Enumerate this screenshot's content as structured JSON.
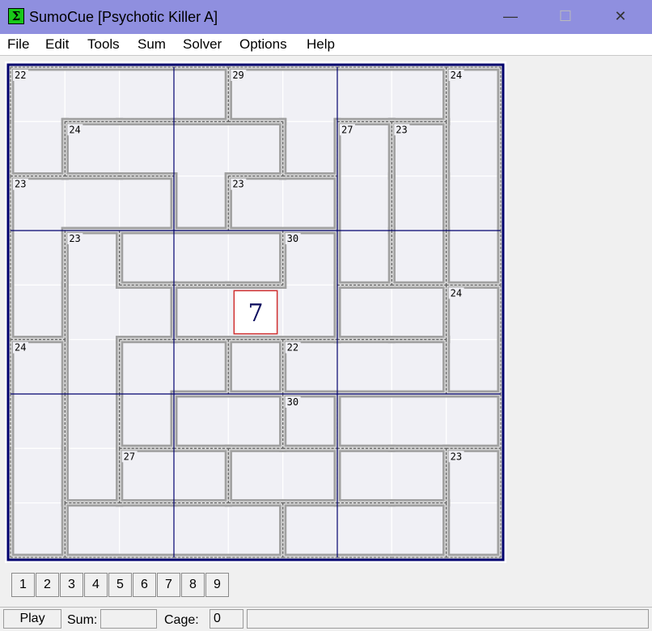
{
  "window": {
    "title": "SumoCue [Psychotic Killer A]",
    "minimize_glyph": "—",
    "maximize_glyph": "☐",
    "close_glyph": "✕"
  },
  "app_icon": {
    "glyph": "Σ",
    "icon": "sigma-icon"
  },
  "menu": [
    "File",
    "Edit",
    "Tools",
    "Sum",
    "Solver",
    "Options",
    "Help"
  ],
  "colors": {
    "titlebar": "#8f8fdf",
    "grid_line": "#00006e",
    "cell_bg": "#f0f0f5",
    "cage_border": "#a0a0a0",
    "selected_border": "#d03030",
    "digit": "#101060"
  },
  "board": {
    "size": 9,
    "cage_map": [
      "AAAABBBBC",
      "ADDDDBEFC",
      "GGGDHHEFC",
      "GIJJJKEFC",
      "GIIKKKLLM",
      "NIOOPQQQM",
      "NIORRSTTT",
      "NIUUVVSSW",
      "NXXXXYYYW"
    ],
    "cage_sums": {
      "A": "22",
      "B": "29",
      "C": "24",
      "D": "24",
      "E": "27",
      "G": "23",
      "H": "23",
      "F": "23",
      "I": "23",
      "K": "30",
      "M": "24",
      "N": "24",
      "Q": "22",
      "S": "30",
      "U": "27",
      "W": "23"
    },
    "values": [
      {
        "row": 4,
        "col": 4,
        "value": "7"
      }
    ],
    "selected": {
      "row": 4,
      "col": 4
    }
  },
  "digit_buttons": [
    "1",
    "2",
    "3",
    "4",
    "5",
    "6",
    "7",
    "8",
    "9"
  ],
  "status": {
    "mode": "Play",
    "sum_label": "Sum:",
    "sum_value": "",
    "cage_label": "Cage:",
    "cage_value": "0"
  }
}
